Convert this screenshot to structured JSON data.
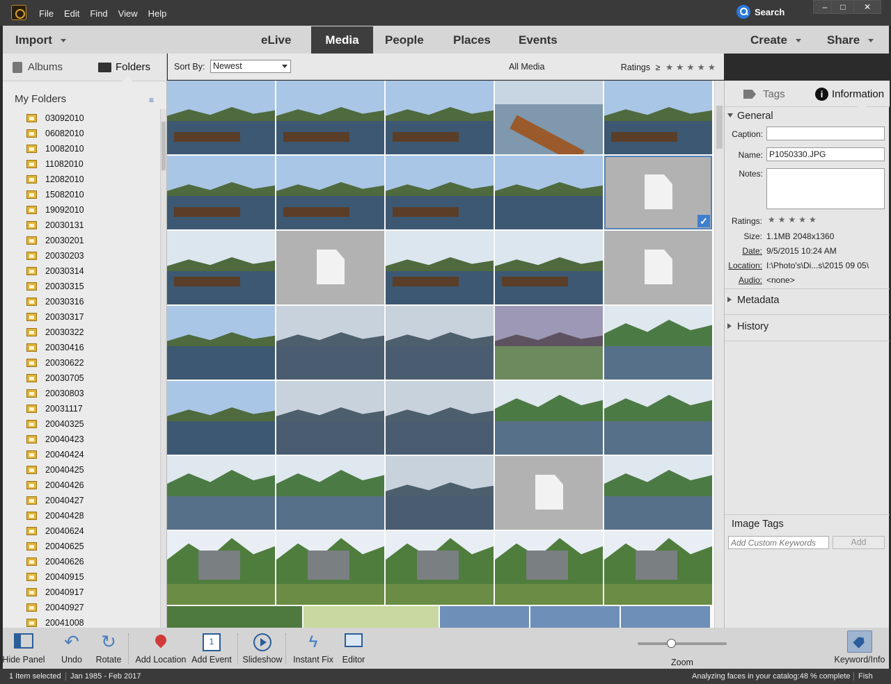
{
  "titlebar": {
    "menu": [
      "File",
      "Edit",
      "Find",
      "View",
      "Help"
    ],
    "search_label": "Search",
    "window_buttons": [
      "–",
      "□",
      "✕"
    ]
  },
  "nav": {
    "import_label": "Import",
    "tabs": [
      "eLive",
      "Media",
      "People",
      "Places",
      "Events"
    ],
    "active_tab": "Media",
    "create_label": "Create",
    "share_label": "Share"
  },
  "left_panel": {
    "tabs": [
      "Albums",
      "Folders"
    ],
    "active_tab": "Folders",
    "heading": "My Folders",
    "folders": [
      "03092010",
      "06082010",
      "10082010",
      "11082010",
      "12082010",
      "15082010",
      "19092010",
      "20030131",
      "20030201",
      "20030203",
      "20030314",
      "20030315",
      "20030316",
      "20030317",
      "20030322",
      "20030416",
      "20030622",
      "20030705",
      "20030803",
      "20031117",
      "20040325",
      "20040423",
      "20040424",
      "20040425",
      "20040426",
      "20040427",
      "20040428",
      "20040624",
      "20040625",
      "20040626",
      "20040915",
      "20040917",
      "20040927",
      "20041008"
    ]
  },
  "sortbar": {
    "sort_label": "Sort By:",
    "sort_value": "Newest",
    "view_label": "All Media",
    "ratings_label": "Ratings",
    "ratings_op": "≥"
  },
  "right_panel": {
    "tabs": [
      "Tags",
      "Information"
    ],
    "active_tab": "Information",
    "general_label": "General",
    "caption_label": "Caption:",
    "caption_value": "",
    "name_label": "Name:",
    "name_value": "P1050330.JPG",
    "notes_label": "Notes:",
    "ratings_label": "Ratings:",
    "size_label": "Size:",
    "size_value": "1.1MB  2048x1360",
    "date_label": "Date:",
    "date_value": "9/5/2015 10:24 AM",
    "location_label": "Location:",
    "location_value": "I:\\Photo's\\Di...s\\2015 09 05\\",
    "audio_label": "Audio:",
    "audio_value": "<none>",
    "metadata_label": "Metadata",
    "history_label": "History",
    "image_tags_label": "Image Tags",
    "keyword_placeholder": "Add Custom Keywords",
    "add_label": "Add"
  },
  "bottom_toolbar": {
    "hide_panel": "Hide Panel",
    "undo": "Undo",
    "rotate": "Rotate",
    "add_location": "Add Location",
    "add_event": "Add Event",
    "slideshow": "Slideshow",
    "instant_fix": "Instant Fix",
    "editor": "Editor",
    "zoom": "Zoom",
    "keyword_info": "Keyword/Info"
  },
  "statusbar": {
    "selected": "1 Item selected",
    "date_range": "Jan 1985 - Feb 2017",
    "analyzing": "Analyzing faces in your catalog:48 % complete",
    "user": "Fish"
  },
  "colors": {
    "accent": "#3f7fd0",
    "dark_chrome": "#3a3a3a",
    "active_tab": "#3e3e3e"
  },
  "icons": [
    "app-logo-icon",
    "search-icon",
    "folder-icon",
    "album-icon",
    "tag-icon",
    "info-icon",
    "hide-panel-icon",
    "undo-icon",
    "rotate-icon",
    "location-pin-icon",
    "calendar-icon",
    "play-icon",
    "lightning-icon",
    "editor-icon",
    "keyword-icon",
    "check-icon",
    "missing-file-icon"
  ]
}
